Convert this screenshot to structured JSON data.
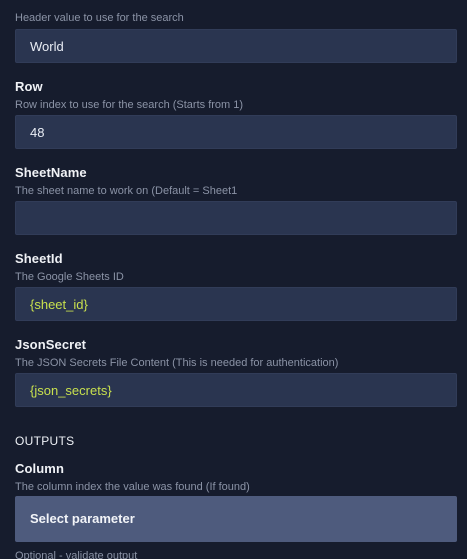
{
  "fields": [
    {
      "label": "",
      "help": "Header value to use for the search",
      "value": "World",
      "placeholder": "",
      "is_variable": false
    },
    {
      "label": "Row",
      "help": "Row index to use for the search (Starts from 1)",
      "value": "48",
      "placeholder": "",
      "is_variable": false
    },
    {
      "label": "SheetName",
      "help": "The sheet name to work on (Default = Sheet1",
      "value": "",
      "placeholder": "",
      "is_variable": false
    },
    {
      "label": "SheetId",
      "help": "The Google Sheets ID",
      "value": "{sheet_id}",
      "placeholder": "",
      "is_variable": true
    },
    {
      "label": "JsonSecret",
      "help": "The JSON Secrets File Content (This is needed for authentication)",
      "value": "{json_secrets}",
      "placeholder": "",
      "is_variable": true
    }
  ],
  "outputs": {
    "section_title": "OUTPUTS",
    "column": {
      "label": "Column",
      "help": "The column index the value was found (If found)",
      "select_label": "Select parameter"
    },
    "cut_off_text": "Optional - validate output"
  },
  "colors": {
    "background": "#161c2d",
    "input_background": "#2a3550",
    "variable_text": "#c8e04e",
    "select_background": "#4e5b7d",
    "help_text": "#8b93a6"
  }
}
